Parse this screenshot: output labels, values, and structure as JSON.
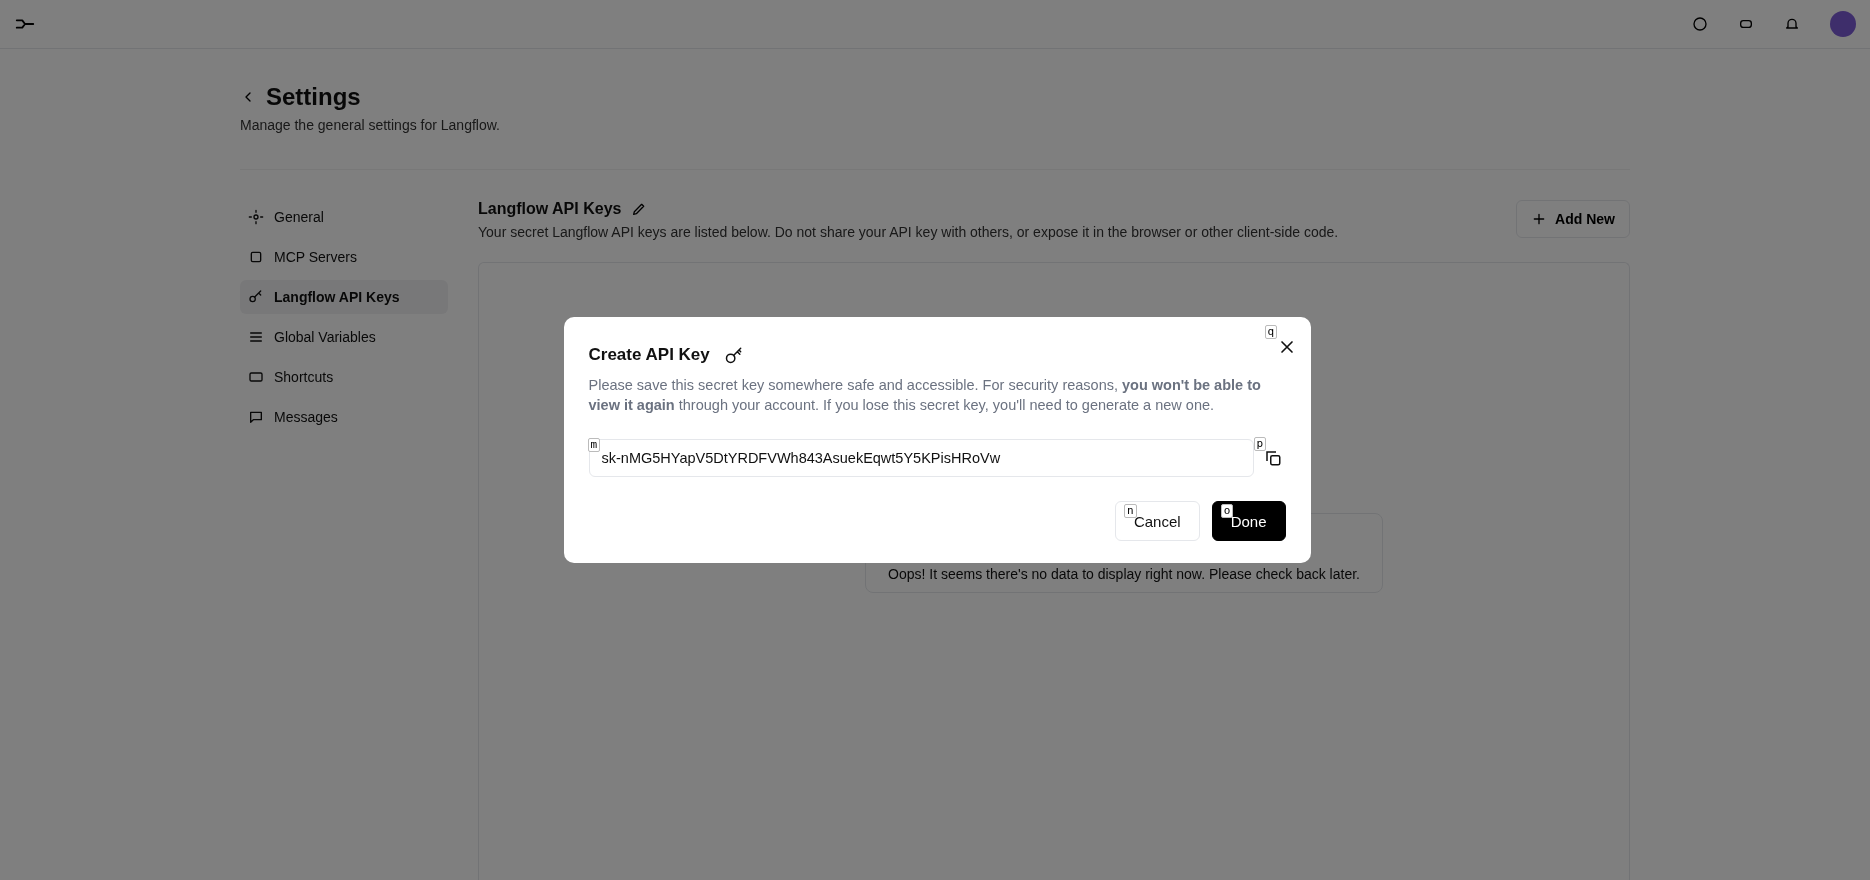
{
  "page": {
    "title": "Settings",
    "subtitle": "Manage the general settings for Langflow."
  },
  "sidebar": {
    "items": [
      {
        "label": "General",
        "selected": false
      },
      {
        "label": "MCP Servers",
        "selected": false
      },
      {
        "label": "Langflow API Keys",
        "selected": true
      },
      {
        "label": "Global Variables",
        "selected": false
      },
      {
        "label": "Shortcuts",
        "selected": false
      },
      {
        "label": "Messages",
        "selected": false
      }
    ]
  },
  "content": {
    "title": "Langflow API Keys",
    "description": "Your secret Langflow API keys are listed below. Do not share your API key with others, or expose it in the browser or other client-side code.",
    "add_button": "Add New",
    "empty_message": "Oops! It seems there's no data to display right now. Please check back later."
  },
  "dialog": {
    "title": "Create API Key",
    "description": "Please save this secret key somewhere safe and accessible. For security reasons, **you won't be able to view it again** through your account. If you lose this secret key, you'll need to generate a new one.",
    "key_value": "sk-nMG5HYapV5DtYRDFVWh843AsuekEqwt5Y5KPisHRoVw",
    "close_hint": "q",
    "field_hint": "m",
    "copy_hint": "p",
    "buttons": [
      {
        "label": "Cancel",
        "kind": "secondary",
        "hint": "n"
      },
      {
        "label": "Done",
        "kind": "primary",
        "hint": "o"
      }
    ]
  }
}
